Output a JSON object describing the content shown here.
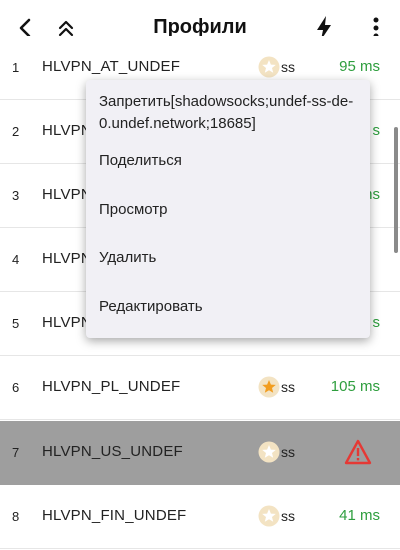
{
  "header": {
    "title": "Профили",
    "back_icon": "arrow-back-icon",
    "collapse_icon": "double-chevron-up-icon",
    "test_icon": "lightning-bolt-icon",
    "more_icon": "more-vertical-icon"
  },
  "colors": {
    "ping_ok": "#2e9e3e",
    "star_active": "#f29d1f",
    "star_inactive": "#f3e3c3",
    "warning": "#e53935",
    "selected_row": "#9e9e9e"
  },
  "rows": [
    {
      "index": "1",
      "name": "HLVPN_AT_UNDEF",
      "protocol": "ss",
      "ping": "95 ms",
      "starred": false
    },
    {
      "index": "2",
      "name": "HLVPN",
      "protocol": "",
      "ping": "s",
      "starred": false
    },
    {
      "index": "3",
      "name": "HLVPN",
      "protocol": "",
      "ping": "ns",
      "starred": false
    },
    {
      "index": "4",
      "name": "HLVPN",
      "protocol": "",
      "ping": "",
      "starred": false
    },
    {
      "index": "5",
      "name": "HLVPN",
      "protocol": "",
      "ping": "s",
      "starred": false
    },
    {
      "index": "6",
      "name": "HLVPN_PL_UNDEF",
      "protocol": "ss",
      "ping": "105 ms",
      "starred": true
    },
    {
      "index": "7",
      "name": "HLVPN_US_UNDEF",
      "protocol": "ss",
      "ping": "",
      "starred": false,
      "status_icon": "warning-triangle-icon"
    },
    {
      "index": "8",
      "name": "HLVPN_FIN_UNDEF",
      "protocol": "ss",
      "ping": "41 ms",
      "starred": false
    }
  ],
  "context_menu": {
    "items": [
      "Запретить[shadowsocks;undef-ss-de-0.undef.network;18685]",
      "Поделиться",
      "Просмотр",
      "Удалить",
      "Редактировать"
    ]
  }
}
